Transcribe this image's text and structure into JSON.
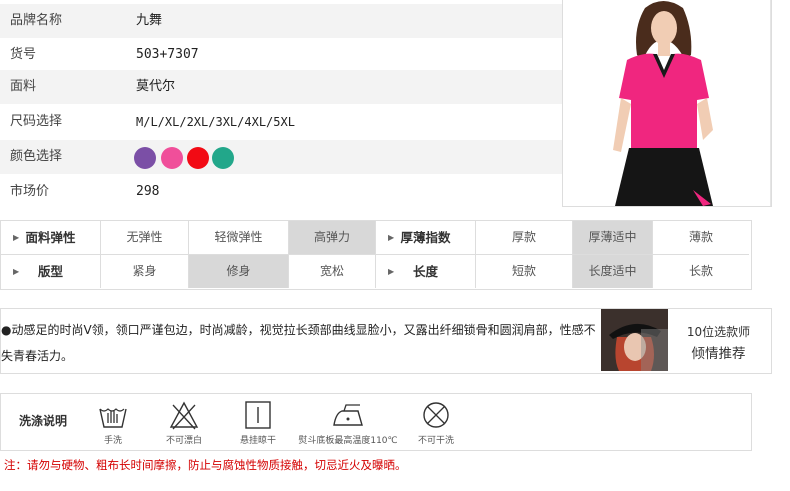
{
  "spec": {
    "rows": [
      {
        "key": "品牌名称",
        "value": "九舞"
      },
      {
        "key": "货号",
        "value": "503+7307"
      },
      {
        "key": "面料",
        "value": "莫代尔"
      },
      {
        "key": "尺码选择",
        "value": "M/L/XL/2XL/3XL/4XL/5XL"
      },
      {
        "key": "颜色选择",
        "value": ""
      },
      {
        "key": "市场价",
        "value": "298"
      }
    ],
    "swatches": [
      "#7b4fa6",
      "#f04f9a",
      "#f20a14",
      "#22a78a"
    ]
  },
  "attributes": {
    "row1_left_label": "面料弹性",
    "row1_left_options": [
      "无弹性",
      "轻微弹性",
      "高弹力"
    ],
    "row1_left_selected": 2,
    "row1_right_label": "厚薄指数",
    "row1_right_options": [
      "厚款",
      "厚薄适中",
      "薄款"
    ],
    "row1_right_selected": 1,
    "row2_left_label": "版型",
    "row2_left_options": [
      "紧身",
      "修身",
      "宽松"
    ],
    "row2_left_selected": 1,
    "row2_right_label": "长度",
    "row2_right_options": [
      "短款",
      "长度适中",
      "长款"
    ],
    "row2_right_selected": 1
  },
  "description": {
    "text": "●动感足的时尚V领，领口严谨包边，时尚减龄，视觉拉长颈部曲线显脸小，又露出纤细锁骨和圆润肩部，性感不失青春活力。",
    "recommend_line1": "10位选款师",
    "recommend_line2": "倾情推荐"
  },
  "wash": {
    "label": "洗涤说明",
    "items": [
      "手洗",
      "不可漂白",
      "悬挂晾干",
      "熨斗底板最高温度110℃",
      "不可干洗"
    ]
  },
  "note": "注：请勿与硬物、粗布长时间摩擦，防止与腐蚀性物质接触，切忌近火及曝晒。"
}
